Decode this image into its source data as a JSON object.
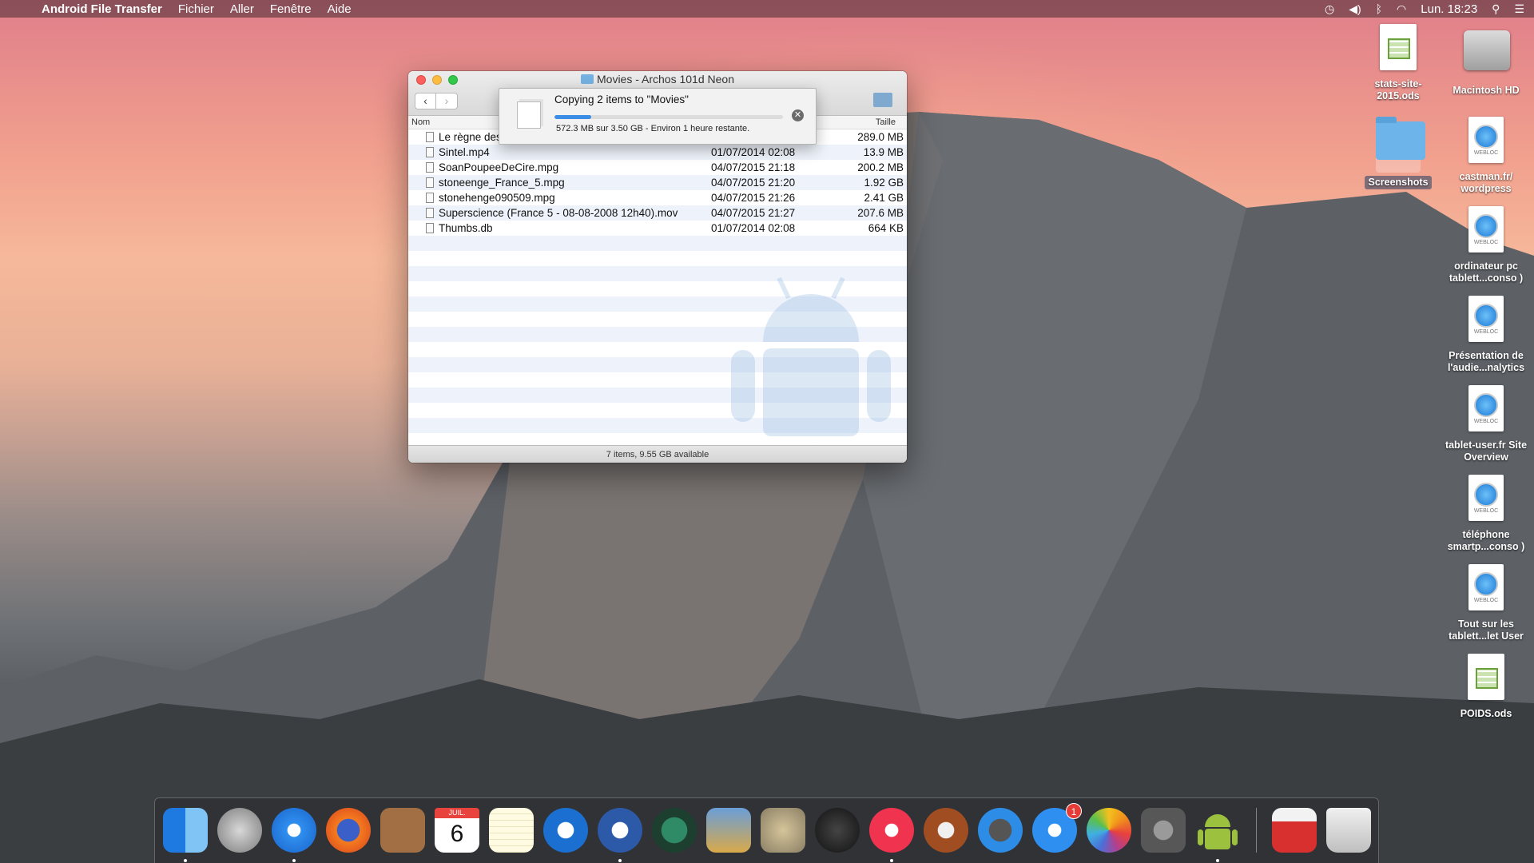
{
  "menubar": {
    "app_name": "Android File Transfer",
    "items": [
      "Fichier",
      "Aller",
      "Fenêtre",
      "Aide"
    ],
    "clock": "Lun. 18:23"
  },
  "window": {
    "title": "Movies - Archos 101d Neon",
    "columns": {
      "name": "Nom",
      "size": "Taille"
    },
    "files": [
      {
        "name": "Le règne des",
        "date": "",
        "size": "289.0 MB"
      },
      {
        "name": "Sintel.mp4",
        "date": "01/07/2014 02:08",
        "size": "13.9 MB"
      },
      {
        "name": "SoanPoupeeDeCire.mpg",
        "date": "04/07/2015 21:18",
        "size": "200.2 MB"
      },
      {
        "name": "stoneenge_France_5.mpg",
        "date": "04/07/2015 21:20",
        "size": "1.92 GB"
      },
      {
        "name": "stonehenge090509.mpg",
        "date": "04/07/2015 21:26",
        "size": "2.41 GB"
      },
      {
        "name": "Superscience (France 5 - 08-08-2008 12h40).mov",
        "date": "04/07/2015 21:27",
        "size": "207.6 MB"
      },
      {
        "name": "Thumbs.db",
        "date": "01/07/2014 02:08",
        "size": "664 KB"
      }
    ],
    "status": "7 items, 9.55 GB available"
  },
  "copy_dialog": {
    "title": "Copying 2 items to \"Movies\"",
    "status": "572.3 MB sur 3.50 GB - Environ 1 heure restante.",
    "progress_fraction": 0.16
  },
  "desktop_icons": [
    {
      "label": "stats-site-2015.ods",
      "kind": "spreadsheet"
    },
    {
      "label": "Macintosh HD",
      "kind": "hard-drive"
    },
    {
      "label": "Screenshots",
      "kind": "folder",
      "selected": true
    },
    {
      "label": "castman.fr/ wordpress",
      "kind": "webloc"
    },
    {
      "label": "ordinateur pc tablett...conso )",
      "kind": "webloc"
    },
    {
      "label": "Présentation de l'audie...nalytics",
      "kind": "webloc"
    },
    {
      "label": "tablet-user.fr Site Overview",
      "kind": "webloc"
    },
    {
      "label": "téléphone smartp...conso )",
      "kind": "webloc"
    },
    {
      "label": "Tout sur les tablett...let User",
      "kind": "webloc"
    },
    {
      "label": "POIDS.ods",
      "kind": "spreadsheet"
    }
  ],
  "webloc_label": "WEBLOC",
  "dock": {
    "calendar_month": "JUIL.",
    "calendar_day": "6",
    "appstore_badge": "1",
    "apps": [
      "finder",
      "launchpad",
      "safari",
      "firefox",
      "contacts",
      "calendar",
      "notes",
      "openoffice",
      "thunderbird",
      "time-machine",
      "preview",
      "gimp",
      "activity-monitor",
      "itunes",
      "ibooks",
      "image-capture",
      "app-store",
      "photos",
      "system-preferences",
      "android-file-transfer",
      "downloads",
      "trash"
    ]
  }
}
